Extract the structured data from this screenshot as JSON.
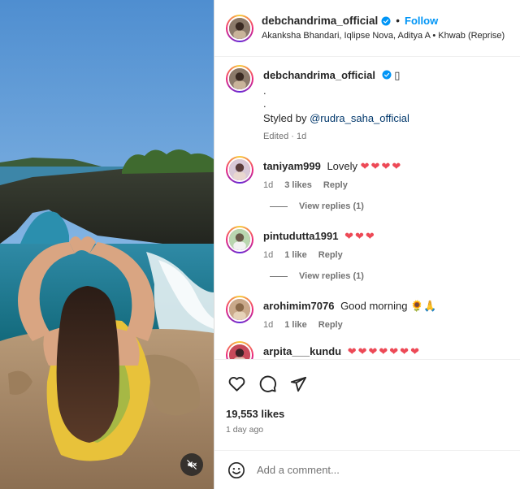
{
  "post": {
    "username": "debchandrima_official",
    "follow_label": "Follow",
    "separator": "•",
    "audio_line": "Akanksha Bhandari, Iqlipse Nova, Aditya A • Khwab (Reprise)"
  },
  "caption": {
    "username": "debchandrima_official",
    "emoji": "▯",
    "dot1": ".",
    "dot2": ".",
    "styled_by": "Styled by ",
    "mention": "@rudra_saha_official",
    "edited": "Edited · 1d"
  },
  "comments": [
    {
      "username": "taniyam999",
      "text": "Lovely",
      "hearts": "❤❤❤❤",
      "time": "1d",
      "likes": "3 likes",
      "reply": "Reply",
      "view_replies": "View replies (1)"
    },
    {
      "username": "pintudutta1991",
      "text": "",
      "hearts": "❤❤❤",
      "time": "1d",
      "likes": "1 like",
      "reply": "Reply",
      "view_replies": "View replies (1)"
    },
    {
      "username": "arohimim7076",
      "text": "Good morning 🌻🙏",
      "hearts": "",
      "time": "1d",
      "likes": "1 like",
      "reply": "Reply"
    },
    {
      "username": "arpita___kundu",
      "text": "",
      "hearts": "❤❤❤❤❤❤❤"
    }
  ],
  "stats": {
    "likes": "19,553 likes",
    "time_ago": "1 day ago"
  },
  "comment_box": {
    "placeholder": "Add a comment..."
  },
  "icons": {
    "like": "heart-icon",
    "comment": "comment-icon",
    "share": "share-icon",
    "emoji": "emoji-icon",
    "mute": "speaker-muted-icon",
    "verified": "verified-badge-icon"
  },
  "colors": {
    "accent": "#0095f6",
    "heart": "#ed4956",
    "muted_text": "#737373",
    "mention": "#00376b"
  }
}
